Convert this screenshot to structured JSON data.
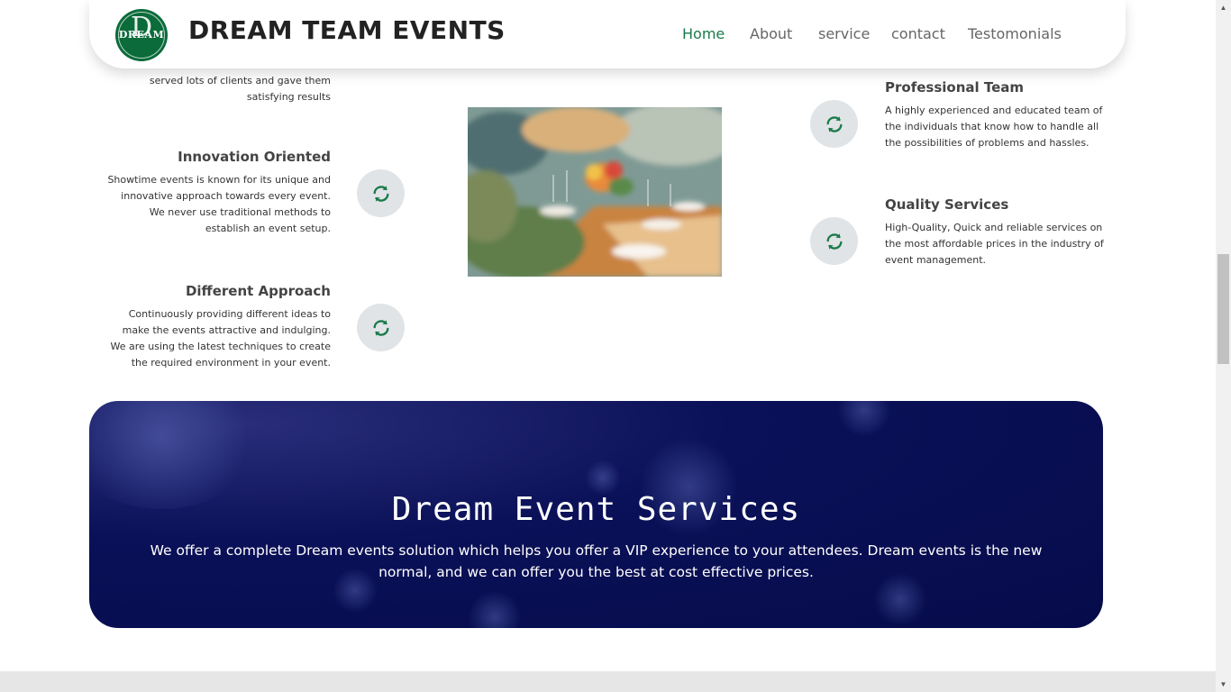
{
  "navbar": {
    "logo_letter": "D",
    "logo_word": "DREAM",
    "brand": "DREAM TEAM EVENTS",
    "links": [
      {
        "label": "Home",
        "active": true
      },
      {
        "label": "About"
      },
      {
        "label": "service"
      },
      {
        "label": "contact"
      },
      {
        "label": "Testomonials"
      }
    ]
  },
  "features": {
    "partial_top_left": [
      "served lots of clients and gave them",
      "satisfying results"
    ],
    "left": [
      {
        "title": "Innovation Oriented",
        "lines": [
          "Showtime events is known for its unique and",
          "innovative approach towards every event.",
          "We never use traditional methods to",
          "establish an event setup."
        ]
      },
      {
        "title": "Different Approach",
        "lines": [
          "Continuously providing different ideas to",
          "make the events attractive and indulging.",
          "We are using the latest techniques to create",
          "the required environment in your event."
        ]
      }
    ],
    "right": [
      {
        "title": "Professional Team",
        "lines": [
          "A highly experienced and educated team of",
          "the individuals that know how to handle all",
          "the possibilities of problems and hassles."
        ]
      },
      {
        "title": "Quality Services",
        "lines": [
          "High-Quality, Quick and reliable services on",
          "the most affordable prices in the industry of",
          "event management."
        ]
      }
    ],
    "icon": "refresh-icon",
    "icon_color": "#1a7a4a"
  },
  "banner": {
    "title": "Dream Event Services",
    "text": "We offer a complete Dream events solution which helps you offer a VIP experience to your attendees. Dream events is the new normal, and we can offer you the best at cost effective prices."
  },
  "colors": {
    "accent": "#1a7a4a",
    "banner_bg": "#050b4a"
  }
}
